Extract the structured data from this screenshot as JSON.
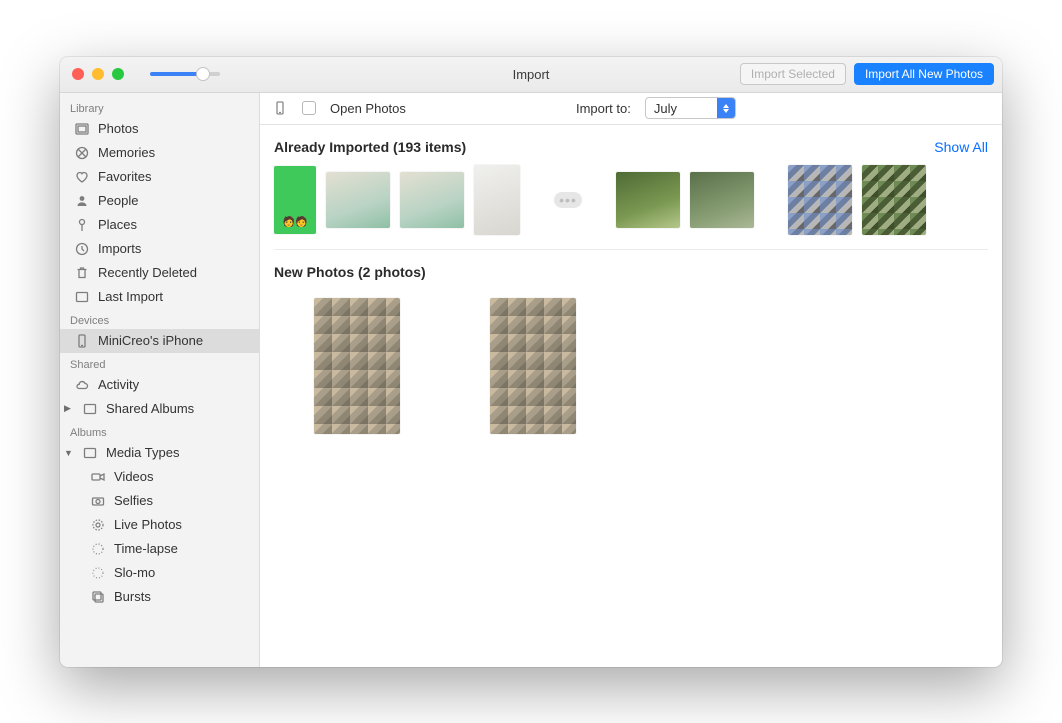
{
  "window": {
    "title": "Import"
  },
  "toolbar_buttons": {
    "import_selected": "Import Selected",
    "import_all": "Import All New Photos"
  },
  "sidebar": {
    "sections": {
      "library": "Library",
      "devices": "Devices",
      "shared": "Shared",
      "albums": "Albums"
    },
    "library_items": [
      {
        "label": "Photos"
      },
      {
        "label": "Memories"
      },
      {
        "label": "Favorites"
      },
      {
        "label": "People"
      },
      {
        "label": "Places"
      },
      {
        "label": "Imports"
      },
      {
        "label": "Recently Deleted"
      },
      {
        "label": "Last Import"
      }
    ],
    "devices": [
      {
        "label": "MiniCreo's iPhone"
      }
    ],
    "shared": [
      {
        "label": "Activity"
      },
      {
        "label": "Shared Albums"
      }
    ],
    "albums": [
      {
        "label": "Media Types",
        "children": [
          {
            "label": "Videos"
          },
          {
            "label": "Selfies"
          },
          {
            "label": "Live Photos"
          },
          {
            "label": "Time-lapse"
          },
          {
            "label": "Slo-mo"
          },
          {
            "label": "Bursts"
          }
        ]
      }
    ]
  },
  "main": {
    "open_photos_label": "Open Photos",
    "import_to_label": "Import to:",
    "import_to_value": "July",
    "already_imported_heading": "Already Imported (193 items)",
    "already_imported_count": 193,
    "show_all": "Show All",
    "new_photos_heading": "New Photos (2 photos)",
    "new_photos_count": 2
  }
}
